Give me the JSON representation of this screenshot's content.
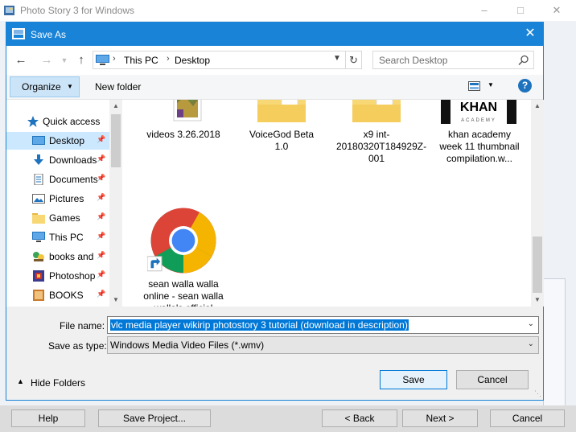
{
  "app": {
    "title": "Photo Story 3 for Windows",
    "buttons": {
      "help": "Help",
      "save_project": "Save Project...",
      "back": "< Back",
      "next": "Next >",
      "cancel": "Cancel"
    }
  },
  "dialog": {
    "title": "Save As",
    "address": {
      "crumbs": [
        "This PC",
        "Desktop"
      ]
    },
    "search_placeholder": "Search Desktop",
    "toolbar": {
      "organize": "Organize",
      "new_folder": "New folder",
      "help": "?"
    },
    "nav": {
      "quick_access": "Quick access",
      "items": [
        {
          "label": "Desktop",
          "icon": "desktop-icon",
          "selected": true
        },
        {
          "label": "Downloads",
          "icon": "downloads-icon"
        },
        {
          "label": "Documents",
          "icon": "documents-icon"
        },
        {
          "label": "Pictures",
          "icon": "pictures-icon"
        },
        {
          "label": "Games",
          "icon": "folder-icon"
        },
        {
          "label": "This PC",
          "icon": "this-pc-icon"
        },
        {
          "label": "books and",
          "icon": "books-icon"
        },
        {
          "label": "Photoshop",
          "icon": "photoshop-icon"
        },
        {
          "label": "BOOKS",
          "icon": "books-folder-icon"
        }
      ]
    },
    "files": [
      {
        "name": "videos 3.26.2018",
        "icon": "image-thumbnail-icon"
      },
      {
        "name": "VoiceGod Beta 1.0",
        "icon": "folder-icon"
      },
      {
        "name": "x9 int-20180320T184929Z-001",
        "icon": "folder-icon"
      },
      {
        "name": "khan academy week 11 thumbnail compilation.w...",
        "icon": "video-thumbnail-icon",
        "thumb_text": "KHAN",
        "thumb_subtext": "ACADEMY"
      },
      {
        "name": "sean walla walla online - sean walla walla's official websit...",
        "icon": "chrome-shortcut-icon"
      }
    ],
    "file_name_label": "File name:",
    "file_name_value": "vlc media player wikirip photostory 3 tutorial (download in description)",
    "save_type_label": "Save as type:",
    "save_type_value": "Windows Media Video Files (*.wmv)",
    "hide_folders": "Hide Folders",
    "save": "Save",
    "cancel": "Cancel"
  },
  "colors": {
    "accent": "#1883d7",
    "selection": "#cce8ff",
    "folder": "#f8d775"
  }
}
